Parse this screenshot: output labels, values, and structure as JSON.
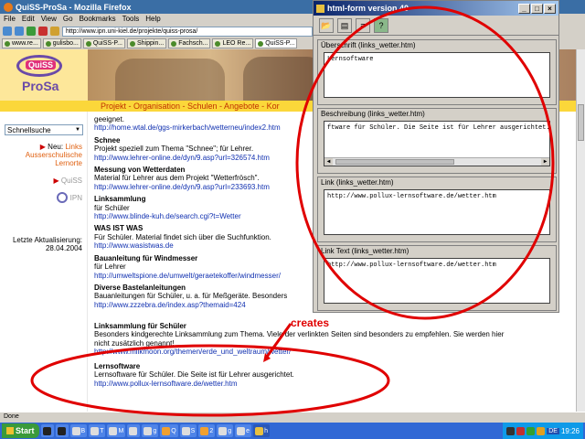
{
  "browser": {
    "title": "QuiSS-ProSa - Mozilla Firefox",
    "menu": [
      "File",
      "Edit",
      "View",
      "Go",
      "Bookmarks",
      "Tools",
      "Help"
    ],
    "url": "http://www.ipn.uni-kiel.de/projekte/quiss-prosa/",
    "tabs": [
      "www.re...",
      "gulisbo...",
      "QuiSS-P...",
      "Shippin...",
      "Fachsch...",
      "LEO Re...",
      "QuiSS-P..."
    ],
    "status": "Done"
  },
  "site": {
    "logo_top": "QuiSS",
    "logo_bottom": "ProSa",
    "nav_strip": "Projekt - Organisation - Schulen - Angebote - Kor",
    "search_select": "Schnellsuche",
    "neu_label": "Neu:",
    "neu_link": "Links",
    "neu_link2": "Ausserschulische Lernorte",
    "quiss_link": "QuiSS",
    "ipn_link": "IPN",
    "update_label": "Letzte Aktualisierung:",
    "update_date": "28.04.2004"
  },
  "entries": [
    {
      "title": "",
      "desc": "geeignet.",
      "link": "http://home.wtal.de/ggs-mirkerbach/wetterneu/index2.htm"
    },
    {
      "title": "Schnee",
      "desc": "Projekt speziell zum Thema \"Schnee\"; für Lehrer.",
      "link": "http://www.lehrer-online.de/dyn/9.asp?url=326574.htm"
    },
    {
      "title": "Messung von Wetterdaten",
      "desc": "Material für Lehrer aus dem Projekt \"Wetterfrösch\".",
      "link": "http://www.lehrer-online.de/dyn/9.asp?url=233693.htm"
    },
    {
      "title": "Linksammlung",
      "desc": "für Schüler",
      "link": "http://www.blinde-kuh.de/search.cgi?t=Wetter"
    },
    {
      "title": "WAS IST WAS",
      "desc": "Für Schüler. Material findet sich über die Suchfunktion.",
      "link": "http://www.wasistwas.de"
    },
    {
      "title": "Bauanleitung für Windmesser",
      "desc": "für Lehrer",
      "link": "http://umweltspione.de/umwelt/geraetekoffer/windmesser/"
    },
    {
      "title": "Diverse Bastelanleitungen",
      "desc": "Bauanleitungen für Schüler, u. a. für Meßgeräte. Besonders",
      "link": "http://www.zzzebra.de/index.asp?themaid=424"
    }
  ],
  "wide_entries": [
    {
      "title": "Linksammlung für Schüler",
      "desc": "Besonders kindgerechte Linksammlung zum Thema. Viele der verlinkten Seiten sind besonders zu empfehlen. Sie werden hier nicht zusätzlich genannt!",
      "link": "http://www.milkmoon.org/themen/erde_und_weltraum/wetter/"
    },
    {
      "title": "Lernsoftware",
      "desc": "Lernsoftware für Schüler. Die Seite ist für Lehrer ausgerichtet.",
      "link": "http://www.pollux-lernsoftware.de/wetter.htm"
    }
  ],
  "form": {
    "title": "html-form version 40",
    "fields": [
      {
        "label": "Überschrift (links_wetter.htm)",
        "value": "Lernsoftware"
      },
      {
        "label": "Beschreibung (links_wetter.htm)",
        "value": "ftware für Schüler. Die Seite ist für Lehrer ausgerichtet."
      },
      {
        "label": "Link (links_wetter.htm)",
        "value": "http://www.pollux-lernsoftware.de/wetter.htm"
      },
      {
        "label": "Link Text (links_wetter.htm)",
        "value": "http://www.pollux-lernsoftware.de/wetter.htm"
      }
    ]
  },
  "annotation": "creates",
  "taskbar": {
    "start": "Start",
    "items": [
      "",
      "",
      "B",
      "T",
      "M",
      "",
      "g",
      "Q",
      "S",
      "2",
      "g",
      "e",
      "h"
    ],
    "clock": "19:26",
    "lang": "DE"
  },
  "colors": {
    "annotation_red": "#e00000",
    "site_yellow": "#fbd73a",
    "nav_red": "#c03000",
    "link_blue": "#1030b0"
  }
}
